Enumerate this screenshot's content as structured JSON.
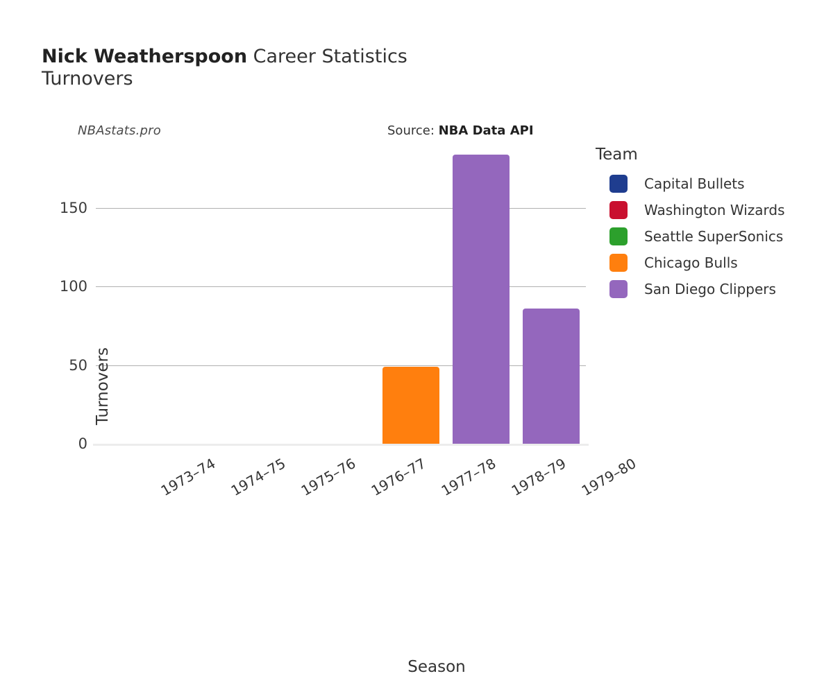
{
  "header": {
    "title_player": "Nick Weatherspoon",
    "title_suffix": " Career Statistics",
    "title_metric": "Turnovers",
    "watermark": "NBAstats.pro",
    "source_prefix": "Source: ",
    "source_name": "NBA Data API"
  },
  "legend": {
    "title": "Team",
    "items": [
      {
        "label": "Capital Bullets",
        "color": "#1f3d8f"
      },
      {
        "label": "Washington Wizards",
        "color": "#c9102f"
      },
      {
        "label": "Seattle SuperSonics",
        "color": "#2ca02c"
      },
      {
        "label": "Chicago Bulls",
        "color": "#ff7f0e"
      },
      {
        "label": "San Diego Clippers",
        "color": "#9467bd"
      }
    ]
  },
  "chart_data": {
    "type": "bar",
    "title": "Nick Weatherspoon Career Statistics Turnovers",
    "xlabel": "Season",
    "ylabel": "Turnovers",
    "categories": [
      "1973–74",
      "1974–75",
      "1975–76",
      "1976–77",
      "1977–78",
      "1978–79",
      "1979–80"
    ],
    "values": [
      null,
      null,
      null,
      null,
      49,
      184,
      86
    ],
    "bar_teams": [
      null,
      null,
      null,
      null,
      "Chicago Bulls",
      "San Diego Clippers",
      "San Diego Clippers"
    ],
    "bar_colors": [
      null,
      null,
      null,
      null,
      "#ff7f0e",
      "#9467bd",
      "#9467bd"
    ],
    "ylim": [
      0,
      188
    ],
    "yticks": [
      0,
      50,
      100,
      150
    ],
    "ytick_labels": [
      "0",
      "50",
      "100",
      "150"
    ],
    "grid": "y-only",
    "legend_position": "right",
    "series": [
      {
        "name": "Chicago Bulls",
        "values": [
          null,
          null,
          null,
          null,
          49,
          null,
          null
        ]
      },
      {
        "name": "San Diego Clippers",
        "values": [
          null,
          null,
          null,
          null,
          null,
          184,
          86
        ]
      }
    ]
  }
}
